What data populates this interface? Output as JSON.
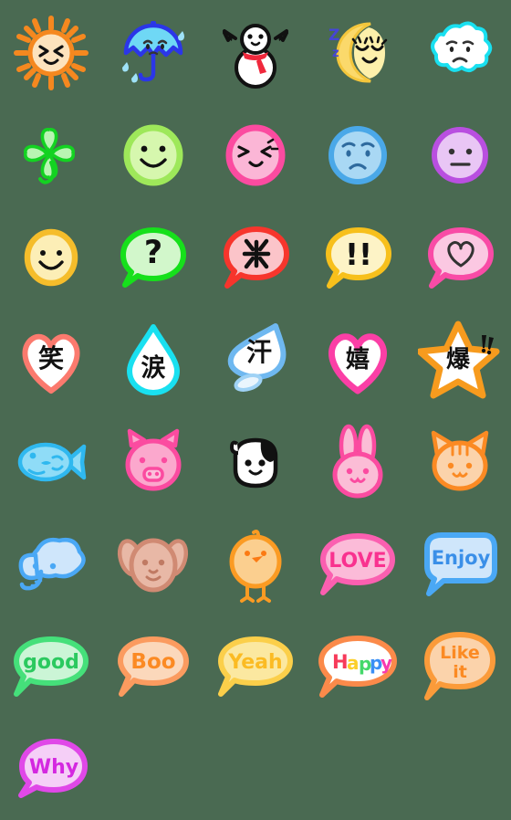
{
  "sheet": {
    "background_color": "#4a6a52",
    "columns": 5,
    "rows": 8,
    "cell_size": 112,
    "total_emoji": 36,
    "style": "hand-drawn cute emoji sticker set"
  },
  "emoji": [
    {
      "index": 1,
      "name": "sun-smiling",
      "kind": "weather",
      "label": "",
      "colors": {
        "outline": "#f5881f",
        "fill": "#fde3bd",
        "accent": "#f5881f"
      }
    },
    {
      "index": 2,
      "name": "umbrella-rain-sad",
      "kind": "weather",
      "label": "",
      "colors": {
        "outline": "#2b36e8",
        "fill": "#6fd8f5",
        "accent": "#7fd4f2"
      }
    },
    {
      "index": 3,
      "name": "snowman-scarf",
      "kind": "weather",
      "label": "",
      "colors": {
        "outline": "#111111",
        "fill": "#ffffff",
        "accent": "#f0283c"
      }
    },
    {
      "index": 4,
      "name": "crescent-moon-sleeping",
      "kind": "weather",
      "label": "Z",
      "colors": {
        "outline": "#f4c63c",
        "fill": "#fdf0ab",
        "accent": "#4545d8"
      }
    },
    {
      "index": 5,
      "name": "cloud-sad-face",
      "kind": "weather",
      "label": "",
      "colors": {
        "outline": "#19e0f0",
        "fill": "#ffffff",
        "accent": "#111111"
      }
    },
    {
      "index": 6,
      "name": "four-leaf-clover",
      "kind": "nature",
      "label": "",
      "colors": {
        "outline": "#13d321",
        "fill": "#b9f5b2",
        "accent": "#13d321"
      }
    },
    {
      "index": 7,
      "name": "face-smile-green",
      "kind": "face",
      "label": "",
      "colors": {
        "outline": "#9ee85a",
        "fill": "#d6f7ae",
        "accent": "#111111"
      }
    },
    {
      "index": 8,
      "name": "face-wink-pink",
      "kind": "face",
      "label": "",
      "colors": {
        "outline": "#fb4ba0",
        "fill": "#fbb6d6",
        "accent": "#111111"
      }
    },
    {
      "index": 9,
      "name": "face-sad-blue",
      "kind": "face",
      "label": "",
      "colors": {
        "outline": "#4aa8e8",
        "fill": "#a9d8f4",
        "accent": "#2e6a9e"
      }
    },
    {
      "index": 10,
      "name": "face-neutral-purple",
      "kind": "face",
      "label": "",
      "colors": {
        "outline": "#b94fe0",
        "fill": "#e9c6f5",
        "accent": "#333333"
      }
    },
    {
      "index": 11,
      "name": "face-smile-yellow",
      "kind": "face",
      "label": "",
      "colors": {
        "outline": "#f5bd2b",
        "fill": "#fceeb6",
        "accent": "#111111"
      }
    },
    {
      "index": 12,
      "name": "speech-bubble-question",
      "kind": "bubble",
      "label": "?",
      "colors": {
        "outline": "#16e01b",
        "fill": "#d2f7cb",
        "accent": "#111111"
      }
    },
    {
      "index": 13,
      "name": "speech-bubble-anger-mark",
      "kind": "bubble",
      "label": "",
      "colors": {
        "outline": "#f7352c",
        "fill": "#fbc4c9",
        "accent": "#111111"
      }
    },
    {
      "index": 14,
      "name": "speech-bubble-exclamation",
      "kind": "bubble",
      "label": "!!",
      "colors": {
        "outline": "#f7c01c",
        "fill": "#fdf3c6",
        "accent": "#111111"
      }
    },
    {
      "index": 15,
      "name": "speech-bubble-heart",
      "kind": "bubble",
      "label": "",
      "colors": {
        "outline": "#f94ba6",
        "fill": "#fbc8e2",
        "accent": "#333333"
      }
    },
    {
      "index": 16,
      "name": "heart-kanji-warau",
      "kind": "kanji",
      "label": "笑",
      "meaning": "laugh",
      "colors": {
        "outline": "#fb7a6e",
        "fill": "#ffffff",
        "accent": "#111111"
      }
    },
    {
      "index": 17,
      "name": "teardrop-kanji-namida",
      "kind": "kanji",
      "label": "涙",
      "meaning": "tears",
      "colors": {
        "outline": "#19e0f0",
        "fill": "#ffffff",
        "accent": "#111111"
      }
    },
    {
      "index": 18,
      "name": "sweatdrop-kanji-ase",
      "kind": "kanji",
      "label": "汗",
      "meaning": "sweat",
      "colors": {
        "outline": "#6fb8f0",
        "fill": "#ffffff",
        "accent": "#111111"
      }
    },
    {
      "index": 19,
      "name": "heart-kanji-ureshii",
      "kind": "kanji",
      "label": "嬉",
      "meaning": "happy",
      "colors": {
        "outline": "#fb3fa6",
        "fill": "#ffffff",
        "accent": "#111111"
      }
    },
    {
      "index": 20,
      "name": "star-kanji-baku",
      "kind": "kanji",
      "label": "爆",
      "meaning": "explode",
      "colors": {
        "outline": "#f79b1e",
        "fill": "#ffffff",
        "accent": "#111111"
      }
    },
    {
      "index": 21,
      "name": "fish-blue",
      "kind": "animal",
      "label": "",
      "colors": {
        "outline": "#2fb8ef",
        "fill": "#8fdcf7",
        "accent": "#2fb8ef"
      }
    },
    {
      "index": 22,
      "name": "pig-pink",
      "kind": "animal",
      "label": "",
      "colors": {
        "outline": "#fb4ba0",
        "fill": "#fba8cd",
        "accent": "#fb4ba0"
      }
    },
    {
      "index": 23,
      "name": "cow-black-white",
      "kind": "animal",
      "label": "",
      "colors": {
        "outline": "#111111",
        "fill": "#ffffff",
        "accent": "#111111"
      }
    },
    {
      "index": 24,
      "name": "rabbit-pink",
      "kind": "animal",
      "label": "",
      "colors": {
        "outline": "#fb4ba0",
        "fill": "#fbbdd6",
        "accent": "#fb4ba0"
      }
    },
    {
      "index": 25,
      "name": "cat-orange",
      "kind": "animal",
      "label": "",
      "colors": {
        "outline": "#fb8a23",
        "fill": "#fbd3ab",
        "accent": "#fb8a23"
      }
    },
    {
      "index": 26,
      "name": "elephant-blue",
      "kind": "animal",
      "label": "",
      "colors": {
        "outline": "#4aa8f5",
        "fill": "#cfe6fb",
        "accent": "#4aa8f5"
      }
    },
    {
      "index": 27,
      "name": "dog-brown",
      "kind": "animal",
      "label": "",
      "colors": {
        "outline": "#d08a73",
        "fill": "#e8b8a6",
        "accent": "#c07a63"
      }
    },
    {
      "index": 28,
      "name": "chick-orange",
      "kind": "animal",
      "label": "",
      "colors": {
        "outline": "#fb9b23",
        "fill": "#fbcf8f",
        "accent": "#fb7a13"
      }
    },
    {
      "index": 29,
      "name": "speech-bubble-love",
      "kind": "word-bubble",
      "label": "LOVE",
      "colors": {
        "outline": "#fb5fb0",
        "fill": "#fbbbd8",
        "accent": "#f9328f"
      }
    },
    {
      "index": 30,
      "name": "speech-bubble-enjoy",
      "kind": "word-bubble",
      "label": "Enjoy",
      "colors": {
        "outline": "#4aa8f5",
        "fill": "#cfe6fb",
        "accent": "#3a8fe8"
      }
    },
    {
      "index": 31,
      "name": "speech-bubble-good",
      "kind": "word-bubble",
      "label": "good",
      "colors": {
        "outline": "#45e07a",
        "fill": "#cbf5d6",
        "accent": "#2bc95f"
      }
    },
    {
      "index": 32,
      "name": "speech-bubble-boo",
      "kind": "word-bubble",
      "label": "Boo",
      "colors": {
        "outline": "#fb9b5f",
        "fill": "#fbd8bb",
        "accent": "#fb8a23"
      }
    },
    {
      "index": 33,
      "name": "speech-bubble-yeah",
      "kind": "word-bubble",
      "label": "Yeah",
      "colors": {
        "outline": "#fbcf4a",
        "fill": "#fbe8a0",
        "accent": "#fbbb23"
      }
    },
    {
      "index": 34,
      "name": "speech-bubble-happy",
      "kind": "word-bubble",
      "label": "Happy",
      "letters": [
        {
          "char": "H",
          "color": "#f73a5a"
        },
        {
          "char": "a",
          "color": "#fbcf2b"
        },
        {
          "char": "p",
          "color": "#45d86a"
        },
        {
          "char": "p",
          "color": "#3a8ff5"
        },
        {
          "char": "y",
          "color": "#f73ab0"
        }
      ],
      "colors": {
        "outline": "#fb8a4a",
        "fill": "#ffffff",
        "accent": "#f73a5a"
      }
    },
    {
      "index": 35,
      "name": "speech-bubble-like-it",
      "kind": "word-bubble",
      "label": "Like it",
      "label_line1": "Like",
      "label_line2": "it",
      "colors": {
        "outline": "#fb9b3a",
        "fill": "#fbd3ab",
        "accent": "#fb8a23"
      }
    },
    {
      "index": 36,
      "name": "speech-bubble-why",
      "kind": "word-bubble",
      "label": "Why",
      "colors": {
        "outline": "#e048e8",
        "fill": "#f5cff7",
        "accent": "#d428e0"
      }
    }
  ]
}
